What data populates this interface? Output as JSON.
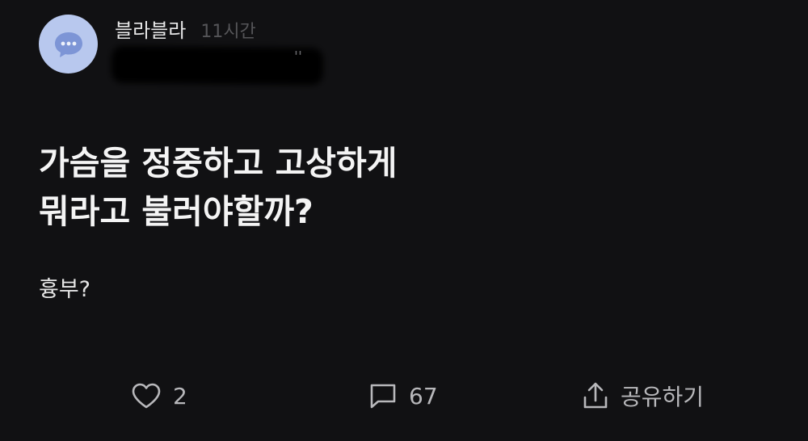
{
  "author": {
    "name": "블라블라",
    "time": "11시간"
  },
  "header": {
    "redacted_tick": "''"
  },
  "post": {
    "title_line1": "가슴을 정중하고 고상하게",
    "title_line2": "뭐라고 불러야할까?",
    "body": "흉부?"
  },
  "actions": {
    "like_count": "2",
    "comment_count": "67",
    "share_label": "공유하기"
  },
  "colors": {
    "background": "#111113",
    "avatar_bg": "#b8c8ee",
    "avatar_bubble": "#7d95d6",
    "muted": "#555558",
    "action": "#b8b8bb"
  },
  "icons": {
    "avatar": "chat-bubble-icon",
    "like": "heart-icon",
    "comment": "comment-icon",
    "share": "share-icon"
  }
}
